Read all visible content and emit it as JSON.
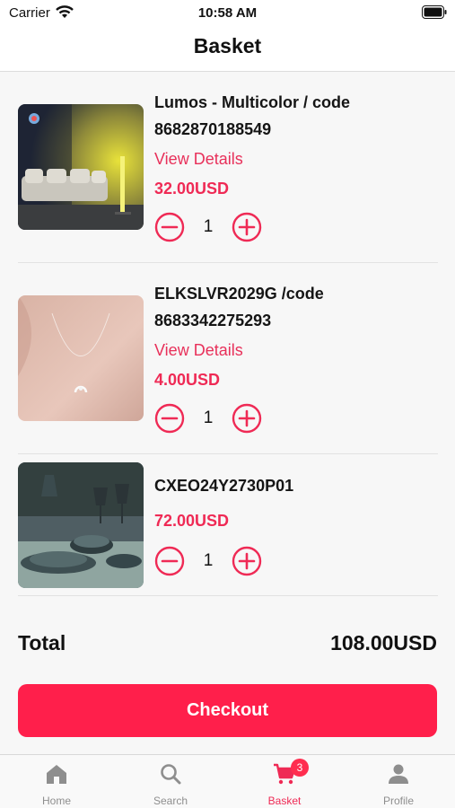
{
  "status_bar": {
    "carrier": "Carrier",
    "time": "10:58 AM"
  },
  "nav": {
    "title": "Basket"
  },
  "items": [
    {
      "name": "Lumos - Multicolor / code 8682870188549",
      "details_label": "View Details",
      "price": "32.00USD",
      "quantity": "1"
    },
    {
      "name": "ELKSLVR2029G /code 8683342275293",
      "details_label": "View Details",
      "price": "4.00USD",
      "quantity": "1"
    },
    {
      "name": "CXEO24Y2730P01",
      "price": "72.00USD",
      "quantity": "1"
    }
  ],
  "summary": {
    "total_label": "Total",
    "total_value": "108.00USD"
  },
  "checkout": {
    "label": "Checkout"
  },
  "tab_bar": {
    "tabs": [
      {
        "label": "Home",
        "icon": "home-icon"
      },
      {
        "label": "Search",
        "icon": "search-icon"
      },
      {
        "label": "Basket",
        "icon": "cart-icon",
        "badge": "3",
        "active": true
      },
      {
        "label": "Profile",
        "icon": "profile-icon"
      }
    ]
  },
  "colors": {
    "accent": "#ff1f4b",
    "price": "#ef2a55",
    "link": "#e8305a"
  }
}
